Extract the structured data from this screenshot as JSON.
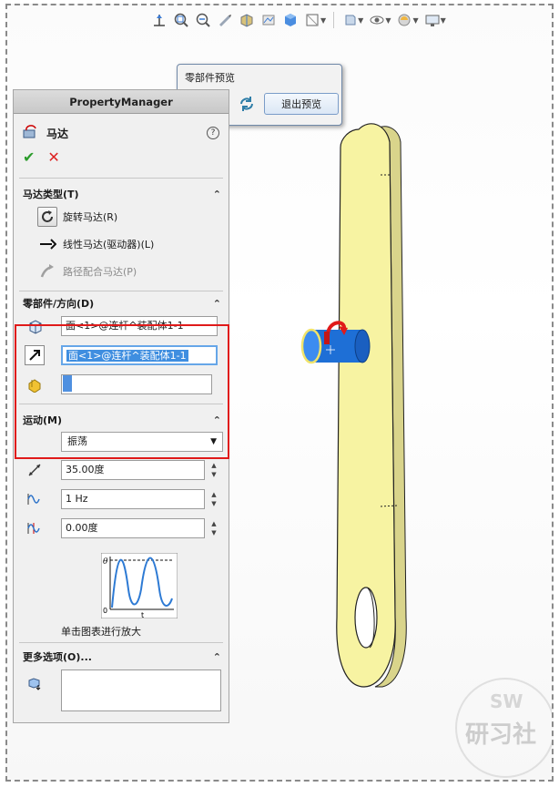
{
  "popup": {
    "title": "零部件预览",
    "exit_label": "退出预览"
  },
  "pm": {
    "header": "PropertyManager",
    "title": "马达",
    "help": "?",
    "ok": "✔",
    "cancel": "✕",
    "motor_type": {
      "heading": "马达类型(T)",
      "options": [
        {
          "label": "旋转马达(R)",
          "selected": true
        },
        {
          "label": "线性马达(驱动器)(L)",
          "selected": false
        },
        {
          "label": "路径配合马达(P)",
          "selected": false,
          "disabled": true
        }
      ]
    },
    "component": {
      "heading": "零部件/方向(D)",
      "face1": "面<1>@连杆^装配体1-1",
      "face2": "面<1>@连杆^装配体1-1",
      "component_value": ""
    },
    "motion": {
      "heading": "运动(M)",
      "type": "振荡",
      "amplitude": "35.00度",
      "frequency": "1 Hz",
      "phase": "0.00度"
    },
    "graph": {
      "y_label": "θ",
      "zero_label": "0",
      "x_label": "t",
      "caption": "单击图表进行放大"
    },
    "more": {
      "heading": "更多选项(O)...",
      "value": ""
    }
  },
  "colors": {
    "part": "#f7f3a2",
    "highlight_red": "#e01a1a",
    "motor_blue": "#1e6fd6"
  },
  "watermark": {
    "text": "研习社",
    "sub": "SW"
  }
}
